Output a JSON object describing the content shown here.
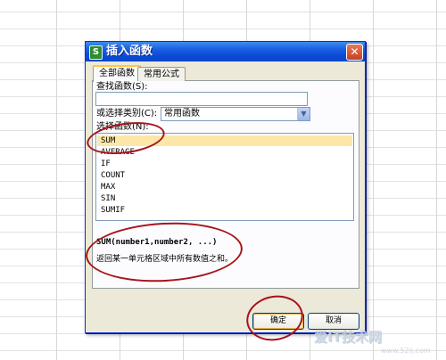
{
  "dialog": {
    "title": "插入函数",
    "app_icon_letter": "S",
    "close_glyph": "✕"
  },
  "tabs": [
    {
      "label": "全部函数",
      "selected": true
    },
    {
      "label": "常用公式",
      "selected": false
    }
  ],
  "search": {
    "label": "查找函数(S):",
    "value": ""
  },
  "category": {
    "label": "或选择类别(C):",
    "value": "常用函数"
  },
  "function_list": {
    "label": "选择函数(N):",
    "items": [
      "SUM",
      "AVERAGE",
      "IF",
      "COUNT",
      "MAX",
      "SIN",
      "SUMIF"
    ],
    "selected_index": 0
  },
  "info": {
    "syntax": "SUM(number1,number2, ...)",
    "description": "返回某一单元格区域中所有数值之和。"
  },
  "buttons": {
    "ok_label": "确定",
    "cancel_label": "取消"
  },
  "watermark": {
    "text": "爱IT技术网",
    "sub": "www.52ij.com"
  },
  "colors": {
    "annotation": "#a5141b",
    "selection": "#fde7a8",
    "titlebar": "#0a4bd6"
  }
}
